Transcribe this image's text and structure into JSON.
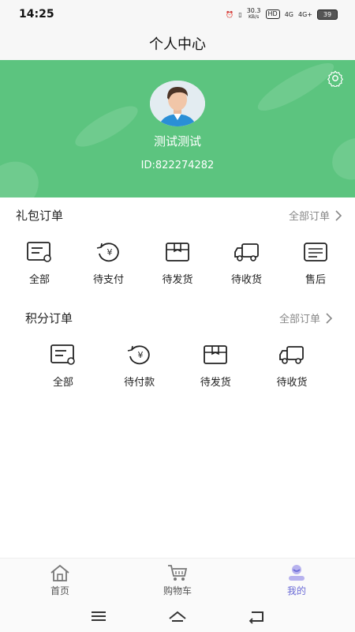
{
  "status": {
    "time": "14:25",
    "speed_top": "30.3",
    "speed_unit": "KB/s",
    "hd": "HD",
    "sig1": "4G",
    "sig2": "4G+",
    "battery": "39"
  },
  "header": {
    "title": "个人中心"
  },
  "profile": {
    "name": "测试测试",
    "id_text": "ID:822274282"
  },
  "gift_orders": {
    "title": "礼包订单",
    "link": "全部订单",
    "items": [
      {
        "label": "全部",
        "icon": "all-orders-icon"
      },
      {
        "label": "待支付",
        "icon": "pending-payment-icon"
      },
      {
        "label": "待发货",
        "icon": "pending-shipment-icon"
      },
      {
        "label": "待收货",
        "icon": "pending-receipt-icon"
      },
      {
        "label": "售后",
        "icon": "after-sales-icon"
      }
    ]
  },
  "points_orders": {
    "title": "积分订单",
    "link": "全部订单",
    "items": [
      {
        "label": "全部",
        "icon": "all-orders-icon"
      },
      {
        "label": "待付款",
        "icon": "pending-payment-icon"
      },
      {
        "label": "待发货",
        "icon": "pending-shipment-icon"
      },
      {
        "label": "待收货",
        "icon": "pending-receipt-icon"
      }
    ]
  },
  "tabbar": {
    "items": [
      {
        "label": "首页",
        "icon": "home-icon"
      },
      {
        "label": "购物车",
        "icon": "cart-icon"
      },
      {
        "label": "我的",
        "icon": "profile-icon"
      }
    ]
  },
  "colors": {
    "brand_green": "#5cc47f",
    "active_tab": "#6b6bd6"
  }
}
